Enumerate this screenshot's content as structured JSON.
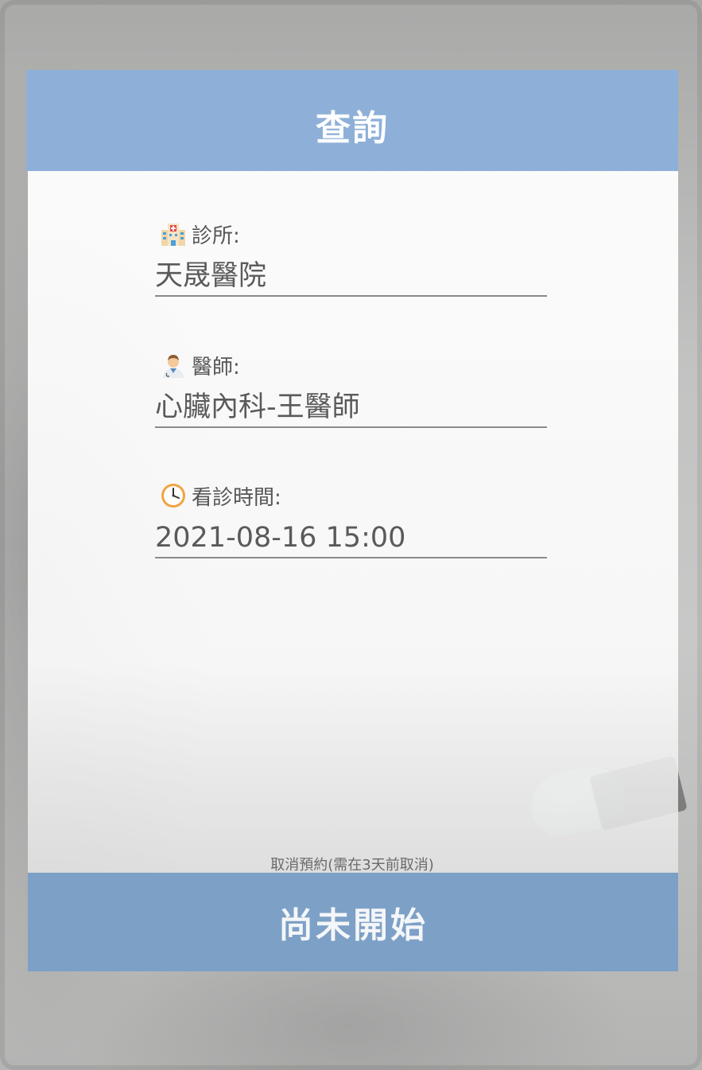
{
  "header": {
    "title": "查詢"
  },
  "fields": [
    {
      "label": "診所:",
      "value": "天晟醫院",
      "icon": "hospital-icon"
    },
    {
      "label": "醫師:",
      "value": "心臟內科-王醫師",
      "icon": "doctor-icon"
    },
    {
      "label": "看診時間:",
      "value": "2021-08-16 15:00",
      "icon": "clock-icon"
    }
  ],
  "cancel": {
    "label": "取消預約(需在3天前取消)"
  },
  "footer": {
    "status_label": "尚未開始"
  },
  "colors": {
    "header_bg": "#8eb0d8",
    "footer_bg": "#7da0c6"
  }
}
